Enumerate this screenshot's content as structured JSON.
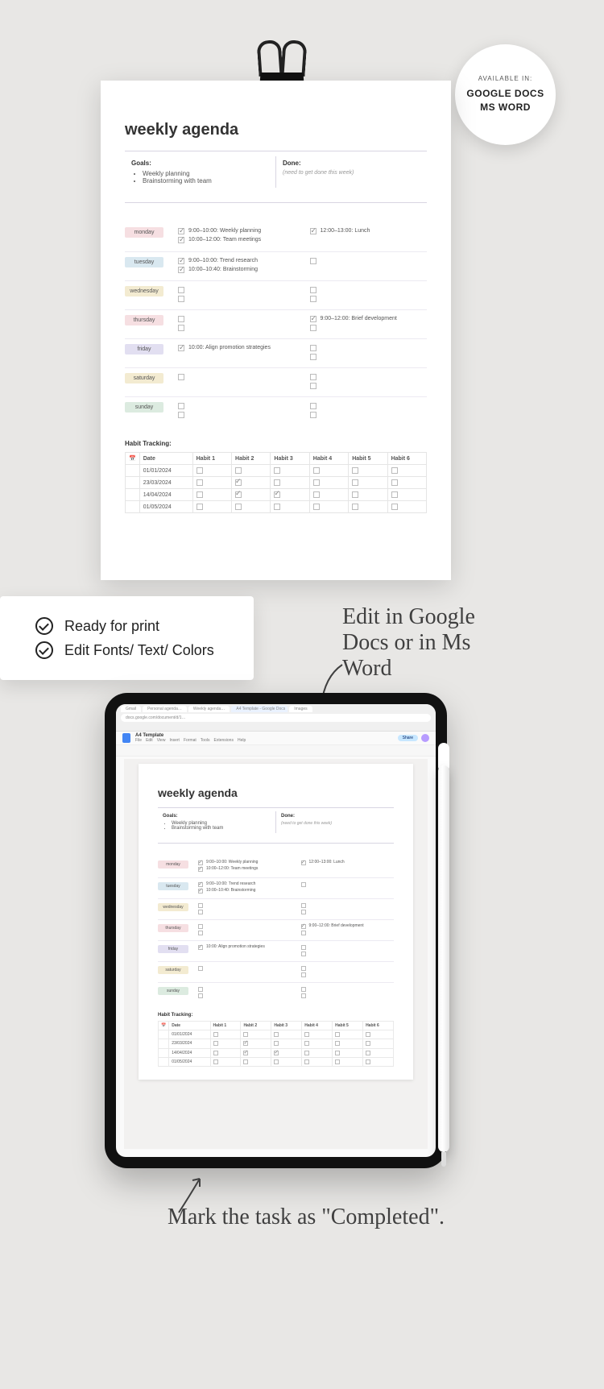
{
  "badge": {
    "avail": "AVAILABLE IN:",
    "docs": "GOOGLE DOCS",
    "word": "MS WORD"
  },
  "card": {
    "row1": "Ready for print",
    "row2": "Edit Fonts/ Text/ Colors"
  },
  "handwriting": {
    "editIn": "Edit in Google Docs or in Ms Word",
    "markCompleted": "Mark the task as \"Completed\"."
  },
  "agenda": {
    "title": "weekly agenda",
    "goalsLabel": "Goals:",
    "goals": [
      "Weekly planning",
      "Brainstorming with team"
    ],
    "doneLabel": "Done:",
    "doneSub": "(need to get done this week)",
    "dayColors": {
      "monday": "#f6dfe2",
      "tuesday": "#d9e8f0",
      "wednesday": "#f3ebd1",
      "thursday": "#f6dfe2",
      "friday": "#e2dff1",
      "saturday": "#f3ebd1",
      "sunday": "#dcebe0"
    },
    "days": [
      {
        "name": "monday",
        "left": [
          {
            "t": "9:00–10:00: Weekly planning",
            "c": true
          },
          {
            "t": "10:00–12:00: Team meetings",
            "c": true
          }
        ],
        "right": [
          {
            "t": "12:00–13:00: Lunch",
            "c": true
          }
        ]
      },
      {
        "name": "tuesday",
        "left": [
          {
            "t": "9:00–10:00: Trend research",
            "c": true
          },
          {
            "t": "10:00–10:40: Brainstorming",
            "c": true
          }
        ],
        "right": [
          {
            "t": "",
            "c": false
          }
        ]
      },
      {
        "name": "wednesday",
        "left": [
          {
            "t": "",
            "c": false
          },
          {
            "t": "",
            "c": false
          }
        ],
        "right": [
          {
            "t": "",
            "c": false
          },
          {
            "t": "",
            "c": false
          }
        ]
      },
      {
        "name": "thursday",
        "left": [
          {
            "t": "",
            "c": false
          },
          {
            "t": "",
            "c": false
          }
        ],
        "right": [
          {
            "t": "9:00–12:00: Brief development",
            "c": true
          },
          {
            "t": "",
            "c": false
          }
        ]
      },
      {
        "name": "friday",
        "left": [
          {
            "t": "10:00: Align promotion strategies",
            "c": true
          }
        ],
        "right": [
          {
            "t": "",
            "c": false
          },
          {
            "t": "",
            "c": false
          }
        ]
      },
      {
        "name": "saturday",
        "left": [
          {
            "t": "",
            "c": false
          }
        ],
        "right": [
          {
            "t": "",
            "c": false
          },
          {
            "t": "",
            "c": false
          }
        ]
      },
      {
        "name": "sunday",
        "left": [
          {
            "t": "",
            "c": false
          },
          {
            "t": "",
            "c": false
          }
        ],
        "right": [
          {
            "t": "",
            "c": false
          },
          {
            "t": "",
            "c": false
          }
        ]
      }
    ],
    "habitTitle": "Habit Tracking:",
    "habitHeaders": [
      "Date",
      "Habit 1",
      "Habit 2",
      "Habit 3",
      "Habit 4",
      "Habit 5",
      "Habit 6"
    ],
    "habitRows": [
      {
        "date": "01/01/2024",
        "h": [
          false,
          false,
          false,
          false,
          false,
          false
        ]
      },
      {
        "date": "23/03/2024",
        "h": [
          false,
          true,
          false,
          false,
          false,
          false
        ]
      },
      {
        "date": "14/04/2024",
        "h": [
          false,
          true,
          true,
          false,
          false,
          false
        ]
      },
      {
        "date": "01/05/2024",
        "h": [
          false,
          false,
          false,
          false,
          false,
          false
        ]
      }
    ]
  },
  "gdocs": {
    "docName": "A4 Template",
    "menus": [
      "File",
      "Edit",
      "View",
      "Insert",
      "Format",
      "Tools",
      "Extensions",
      "Help"
    ],
    "share": "Share"
  }
}
